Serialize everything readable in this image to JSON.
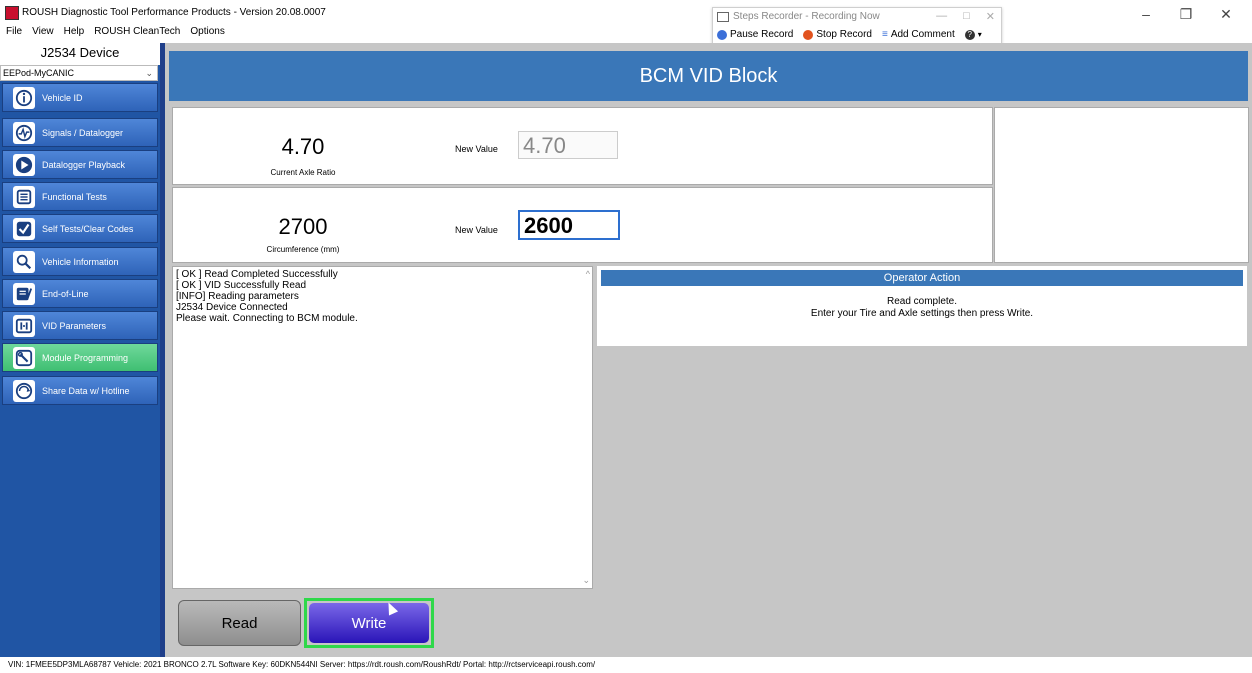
{
  "window": {
    "title": "ROUSH Diagnostic Tool Performance Products - Version 20.08.0007",
    "controls": {
      "minimize": "–",
      "maximize": "❐",
      "close": "✕"
    }
  },
  "menu": [
    "File",
    "View",
    "Help",
    "ROUSH CleanTech",
    "Options"
  ],
  "steps_recorder": {
    "title": "Steps Recorder - Recording Now",
    "pause": "Pause Record",
    "stop": "Stop Record",
    "add_comment": "Add Comment",
    "help": "?",
    "winbtns": {
      "min": "—",
      "max": "□",
      "close": "✕"
    }
  },
  "sidebar": {
    "header": "J2534 Device",
    "device": "EEPod-MyCANIC",
    "items": [
      {
        "label": "Vehicle ID",
        "icon": "info-icon"
      },
      {
        "label": "Signals / Datalogger",
        "icon": "signal-icon"
      },
      {
        "label": "Datalogger Playback",
        "icon": "play-icon"
      },
      {
        "label": "Functional Tests",
        "icon": "list-icon"
      },
      {
        "label": "Self Tests/Clear Codes",
        "icon": "check-icon"
      },
      {
        "label": "Vehicle Information",
        "icon": "search-icon"
      },
      {
        "label": "End-of-Line",
        "icon": "end-of-line-icon"
      },
      {
        "label": "VID Parameters",
        "icon": "vid-icon"
      },
      {
        "label": "Module Programming",
        "icon": "wrench-icon",
        "active": true
      },
      {
        "label": "Share Data w/ Hotline",
        "icon": "share-icon"
      }
    ]
  },
  "main": {
    "title": "BCM VID Block",
    "axle": {
      "current_value": "4.70",
      "current_label": "Current Axle Ratio",
      "new_label": "New Value",
      "new_value": "4.70"
    },
    "circ": {
      "current_value": "2700",
      "current_label": "Circumference (mm)",
      "new_label": "New Value",
      "new_value": "2600"
    },
    "log": [
      "[ OK ] Read Completed Successfully",
      "[ OK ] VID Successfully Read",
      "[INFO] Reading parameters",
      "J2534 Device Connected",
      "Please wait. Connecting to BCM module."
    ],
    "operator": {
      "header": "Operator Action",
      "line1": "Read complete.",
      "line2": "Enter your Tire and Axle settings then press Write."
    },
    "buttons": {
      "read": "Read",
      "write": "Write"
    }
  },
  "status": "VIN: 1FMEE5DP3MLA68787  Vehicle: 2021 BRONCO 2.7L Software Key: 60DKN544NI  Server:  https://rdt.roush.com/RoushRdt/  Portal:  http://rctserviceapi.roush.com/",
  "colors": {
    "sidebar": "#2055a4",
    "header": "#3a77b8",
    "active_nav": "#3fbf72",
    "write_button": "#2a14b8",
    "write_highlight": "#2fd84a"
  }
}
